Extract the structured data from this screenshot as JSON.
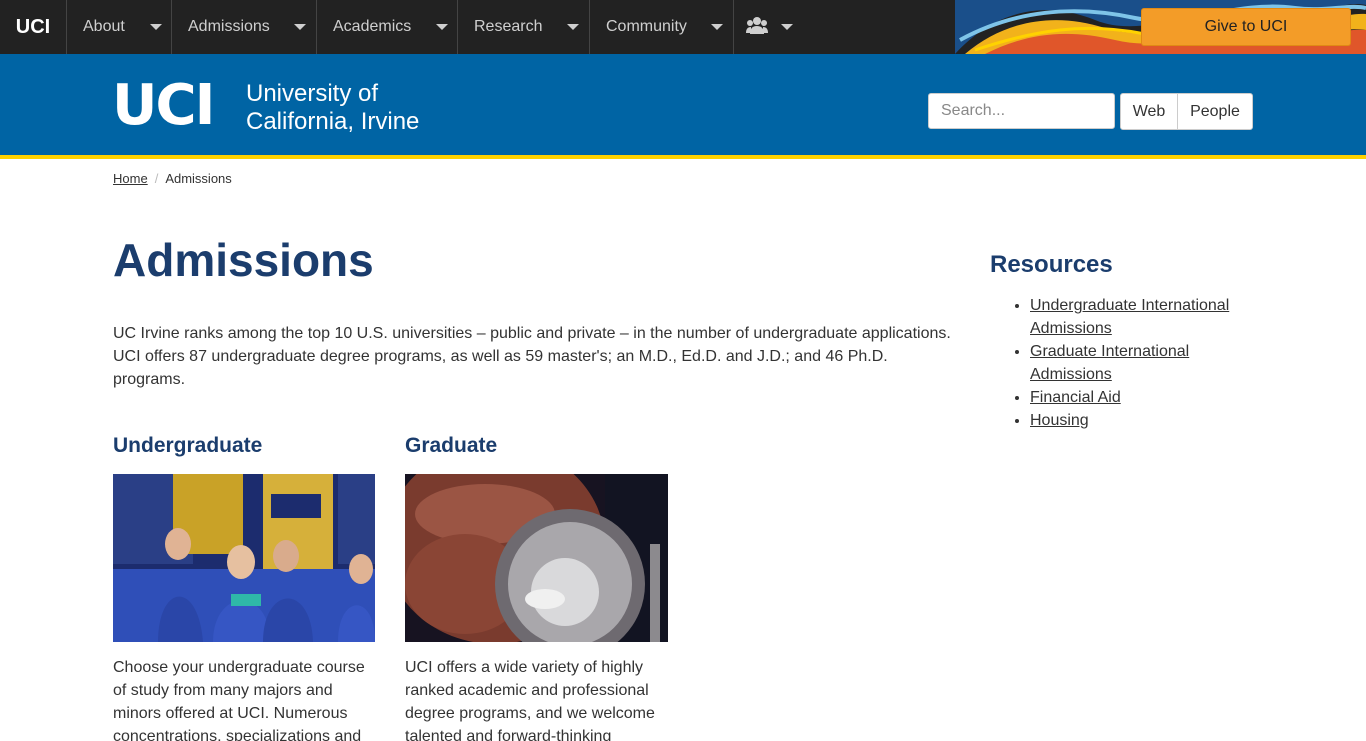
{
  "topnav": {
    "brand": "UCI",
    "items": [
      {
        "label": "About"
      },
      {
        "label": "Admissions"
      },
      {
        "label": "Academics"
      },
      {
        "label": "Research"
      },
      {
        "label": "Community"
      }
    ],
    "people_icon": "people-icon",
    "give_label": "Give to UCI"
  },
  "header": {
    "logo_mark": "UCI",
    "logo_line1": "University of",
    "logo_line2": "California, Irvine",
    "search_placeholder": "Search...",
    "web_label": "Web",
    "people_label": "People"
  },
  "breadcrumb": {
    "home": "Home",
    "separator": "/",
    "current": "Admissions"
  },
  "main": {
    "title": "Admissions",
    "intro": "UC Irvine ranks among the top 10 U.S. universities – public and private – in the number of undergraduate applications. UCI offers 87 undergraduate degree programs, as well as 59 master's; an M.D., Ed.D. and J.D.; and 46 Ph.D. programs.",
    "undergrad": {
      "title": "Undergraduate",
      "text": "Choose your undergraduate course of study from many majors and minors offered at UCI. Numerous concentrations, specializations and"
    },
    "graduate": {
      "title": "Graduate",
      "text": "UCI offers a wide variety of highly ranked academic and professional degree programs, and we welcome talented and forward-thinking"
    }
  },
  "sidebar": {
    "title": "Resources",
    "links": [
      {
        "label": "Undergraduate International Admissions"
      },
      {
        "label": "Graduate International Admissions"
      },
      {
        "label": "Financial Aid"
      },
      {
        "label": "Housing"
      }
    ]
  },
  "colors": {
    "nav_bg": "#222222",
    "header_blue": "#0064a4",
    "gold_accent": "#ffd200",
    "heading_navy": "#1b3d6d",
    "give_orange": "#f39c28"
  }
}
